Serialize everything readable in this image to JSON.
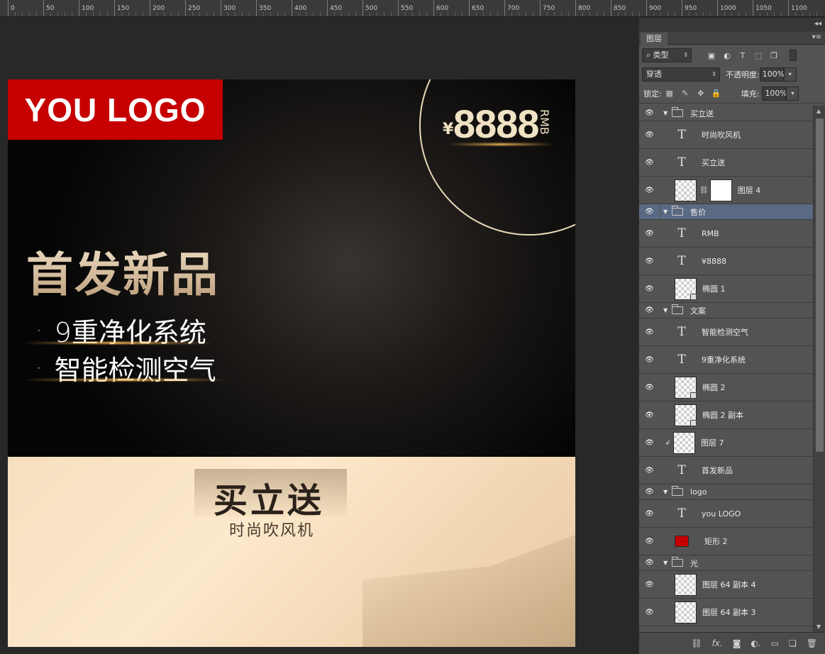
{
  "ruler": {
    "labels": [
      "0",
      "50",
      "100",
      "150",
      "200",
      "250",
      "300",
      "350",
      "400",
      "450",
      "500",
      "550",
      "600",
      "650",
      "700",
      "750",
      "800",
      "850",
      "900",
      "950",
      "1000",
      "1050",
      "1100"
    ]
  },
  "canvas": {
    "logo_text": "YOU LOGO",
    "price_currency": "¥",
    "price_value": "8888",
    "price_unit": "RMB",
    "headline": "首发新品",
    "bullets": [
      "9重净化系统",
      "智能检测空气"
    ],
    "bullet_mark": "·",
    "promo_title": "买立送",
    "promo_subtitle": "时尚吹风机",
    "colors": {
      "logo_red": "#c60000",
      "gold": "#efe3c4",
      "cream": "#fde9cc"
    }
  },
  "panel": {
    "tab_label": "图层",
    "filter_label": "类型",
    "blend_mode": "穿透",
    "opacity_label": "不透明度:",
    "opacity_value": "100%",
    "lock_label": "锁定:",
    "fill_label": "填充:",
    "fill_value": "100%",
    "layers": [
      {
        "label": "买立送",
        "kind": "group"
      },
      {
        "label": "时尚吹风机",
        "kind": "text"
      },
      {
        "label": "买立送",
        "kind": "text"
      },
      {
        "label": "图层 4",
        "kind": "masked"
      },
      {
        "label": "售价",
        "kind": "group",
        "selected": true
      },
      {
        "label": "RMB",
        "kind": "text"
      },
      {
        "label": "¥8888",
        "kind": "text"
      },
      {
        "label": "椭圆 1",
        "kind": "shape"
      },
      {
        "label": "文案",
        "kind": "group"
      },
      {
        "label": "智能检测空气",
        "kind": "text"
      },
      {
        "label": "9重净化系统",
        "kind": "text"
      },
      {
        "label": "椭圆 2",
        "kind": "shape"
      },
      {
        "label": "椭圆 2 副本",
        "kind": "shape"
      },
      {
        "label": "图层 7",
        "kind": "clipped"
      },
      {
        "label": "首发新品",
        "kind": "text"
      },
      {
        "label": "logo",
        "kind": "group"
      },
      {
        "label": "you LOGO",
        "kind": "text"
      },
      {
        "label": "矩形 2",
        "kind": "rect"
      },
      {
        "label": "光",
        "kind": "group"
      },
      {
        "label": "图层 64 副本 4",
        "kind": "pixel"
      },
      {
        "label": "图层 64 副本 3",
        "kind": "pixel"
      }
    ],
    "footer_icons": [
      "link-icon",
      "fx-icon",
      "mask-icon",
      "adjustment-icon",
      "new-group-icon",
      "new-layer-icon",
      "trash-icon"
    ]
  }
}
